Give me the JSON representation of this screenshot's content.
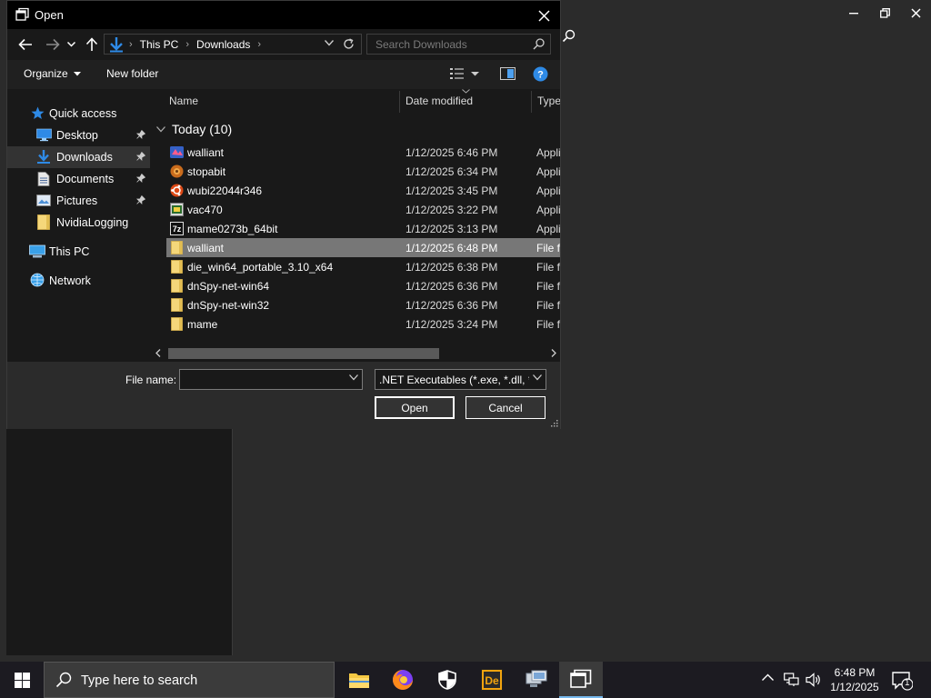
{
  "dialog": {
    "title": "Open",
    "address": {
      "crumbs": [
        "This PC",
        "Downloads"
      ]
    },
    "search_placeholder": "Search Downloads",
    "toolbar": {
      "organize": "Organize",
      "new_folder": "New folder"
    },
    "nav": [
      {
        "label": "Quick access",
        "icon": "star-icon"
      },
      {
        "label": "Desktop",
        "icon": "desktop-icon",
        "pinned": true
      },
      {
        "label": "Downloads",
        "icon": "download-icon",
        "pinned": true,
        "selected": true
      },
      {
        "label": "Documents",
        "icon": "documents-icon",
        "pinned": true
      },
      {
        "label": "Pictures",
        "icon": "pictures-icon",
        "pinned": true
      },
      {
        "label": "NvidiaLogging",
        "icon": "folder-icon"
      },
      {
        "label": "This PC",
        "icon": "pc-icon"
      },
      {
        "label": "Network",
        "icon": "network-icon"
      }
    ],
    "columns": {
      "name": "Name",
      "date": "Date modified",
      "type": "Type"
    },
    "group": "Today (10)",
    "files": [
      {
        "name": "walliant",
        "date": "1/12/2025 6:46 PM",
        "type": "Appli",
        "icon": "walliant-app-icon"
      },
      {
        "name": "stopabit",
        "date": "1/12/2025 6:34 PM",
        "type": "Appli",
        "icon": "stopabit-app-icon"
      },
      {
        "name": "wubi22044r346",
        "date": "1/12/2025 3:45 PM",
        "type": "Appli",
        "icon": "ubuntu-icon"
      },
      {
        "name": "vac470",
        "date": "1/12/2025 3:22 PM",
        "type": "Appli",
        "icon": "vac-app-icon"
      },
      {
        "name": "mame0273b_64bit",
        "date": "1/12/2025 3:13 PM",
        "type": "Appli",
        "icon": "7zip-icon"
      },
      {
        "name": "walliant",
        "date": "1/12/2025 6:48 PM",
        "type": "File fo",
        "icon": "folder-icon",
        "selected": true
      },
      {
        "name": "die_win64_portable_3.10_x64",
        "date": "1/12/2025 6:38 PM",
        "type": "File fo",
        "icon": "folder-icon"
      },
      {
        "name": "dnSpy-net-win64",
        "date": "1/12/2025 6:36 PM",
        "type": "File fo",
        "icon": "folder-icon"
      },
      {
        "name": "dnSpy-net-win32",
        "date": "1/12/2025 6:36 PM",
        "type": "File fo",
        "icon": "folder-icon"
      },
      {
        "name": "mame",
        "date": "1/12/2025 3:24 PM",
        "type": "File fo",
        "icon": "folder-icon"
      }
    ],
    "file_name_label": "File name:",
    "file_name_value": "",
    "filter": ".NET Executables (*.exe, *.dll, *.",
    "open_label": "Open",
    "cancel_label": "Cancel"
  },
  "taskbar": {
    "search_placeholder": "Type here to search",
    "apps": [
      "file-explorer-icon",
      "firefox-icon",
      "security-shield-icon",
      "die-app-icon",
      "remote-desktop-icon",
      "dnspy-window-icon"
    ],
    "clock_time": "6:48 PM",
    "clock_date": "1/12/2025",
    "notification_count": "1"
  },
  "colors": {
    "accent": "#2e8ae6",
    "selection": "#777777",
    "dark_bg": "#191919"
  }
}
